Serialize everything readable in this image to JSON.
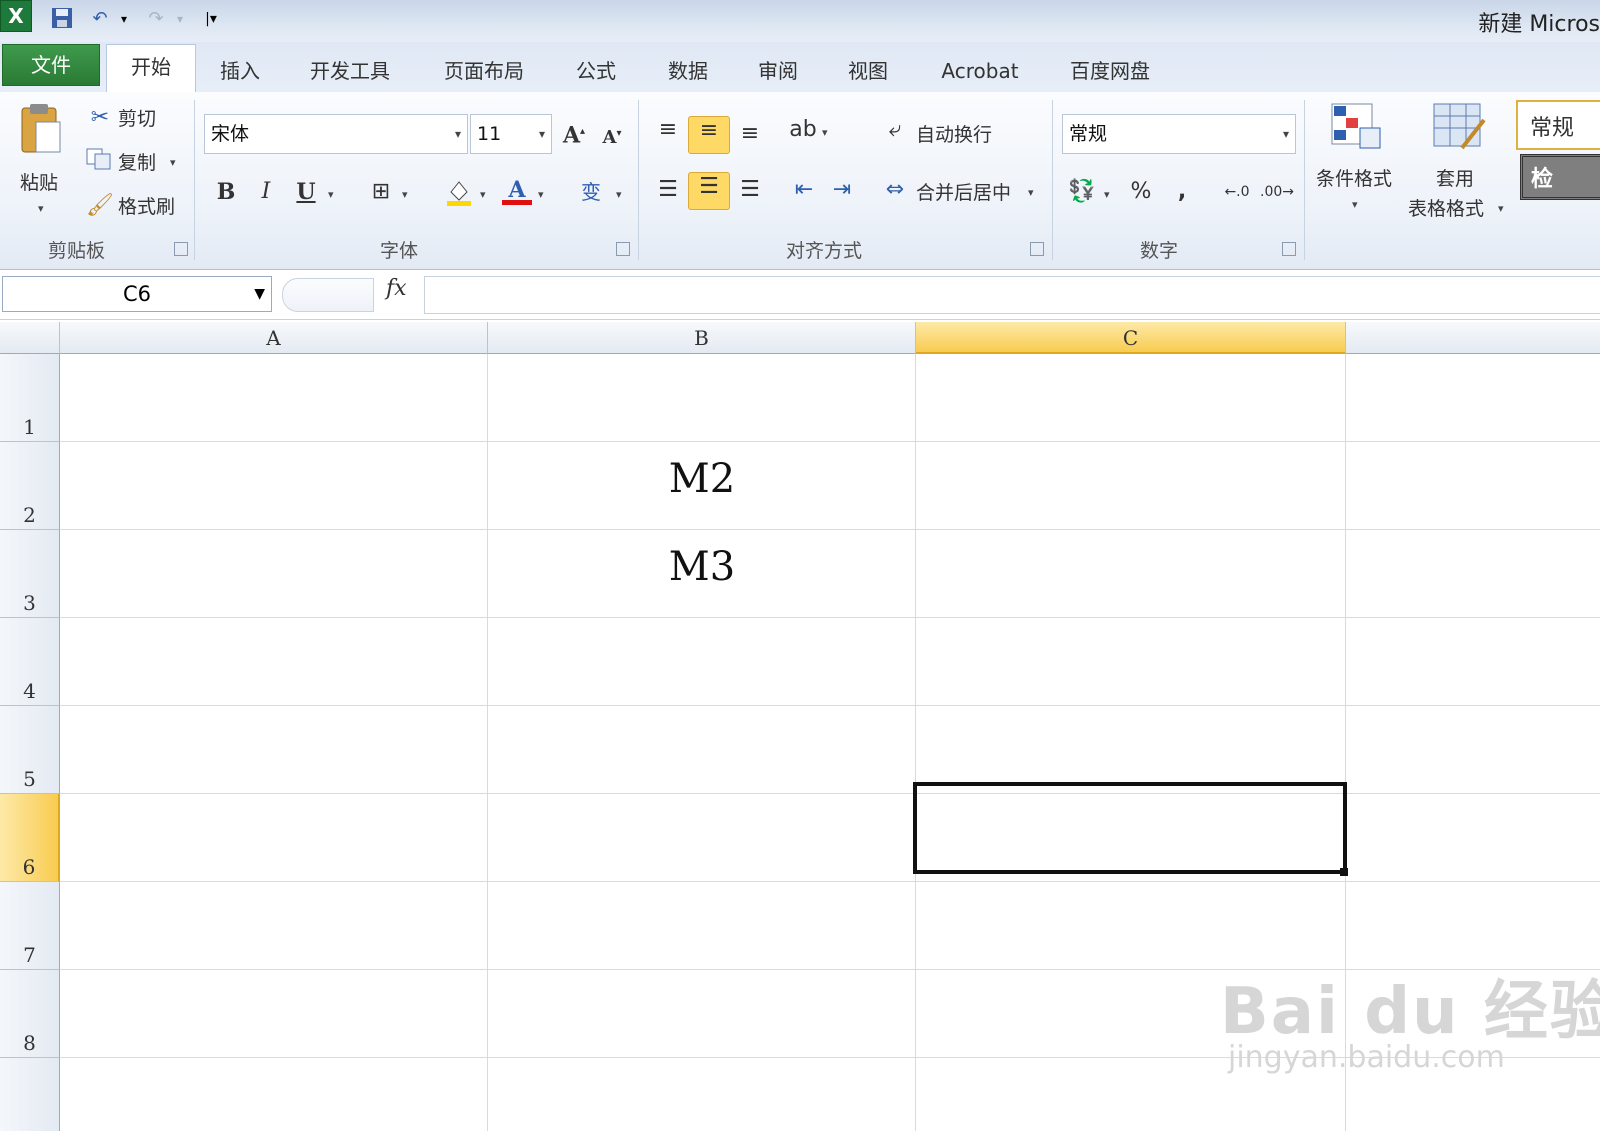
{
  "window": {
    "title": "新建 Micros"
  },
  "quick_access": {
    "items": [
      "excel-logo-icon",
      "save-icon",
      "undo-icon",
      "redo-icon",
      "customize-qat-icon"
    ]
  },
  "tabs": [
    {
      "label": "文件"
    },
    {
      "label": "开始"
    },
    {
      "label": "插入"
    },
    {
      "label": "开发工具"
    },
    {
      "label": "页面布局"
    },
    {
      "label": "公式"
    },
    {
      "label": "数据"
    },
    {
      "label": "审阅"
    },
    {
      "label": "视图"
    },
    {
      "label": "Acrobat"
    },
    {
      "label": "百度网盘"
    }
  ],
  "ribbon": {
    "clipboard": {
      "paste": "粘贴",
      "cut": "剪切",
      "copy": "复制",
      "format_painter": "格式刷",
      "group": "剪贴板"
    },
    "font": {
      "name": "宋体",
      "size": "11",
      "bold": "B",
      "italic": "I",
      "underline": "U",
      "font_color_glyph": "A",
      "group": "字体"
    },
    "alignment": {
      "wrap": "自动换行",
      "merge": "合并后居中",
      "group": "对齐方式"
    },
    "number": {
      "format": "常规",
      "percent": "%",
      "comma": ",",
      "group": "数字"
    },
    "styles": {
      "conditional": "条件格式",
      "table_a": "套用",
      "table_b": "表格格式",
      "normal_style": "常规",
      "check_style": "检"
    }
  },
  "formula_bar": {
    "name_box": "C6",
    "fx": "fx",
    "value": ""
  },
  "sheet": {
    "columns": [
      "A",
      "B",
      "C"
    ],
    "rows": [
      "1",
      "2",
      "3",
      "4",
      "5",
      "6",
      "7",
      "8"
    ],
    "selected_cell": "C6",
    "cells": {
      "B2": "M2",
      "B3": "M3"
    }
  },
  "watermark": {
    "brand": "Bai du 经验",
    "url": "jingyan.baidu.com"
  },
  "accent": {
    "excel_green": "#2a7a35",
    "selection_yellow": "#f8cc50"
  }
}
